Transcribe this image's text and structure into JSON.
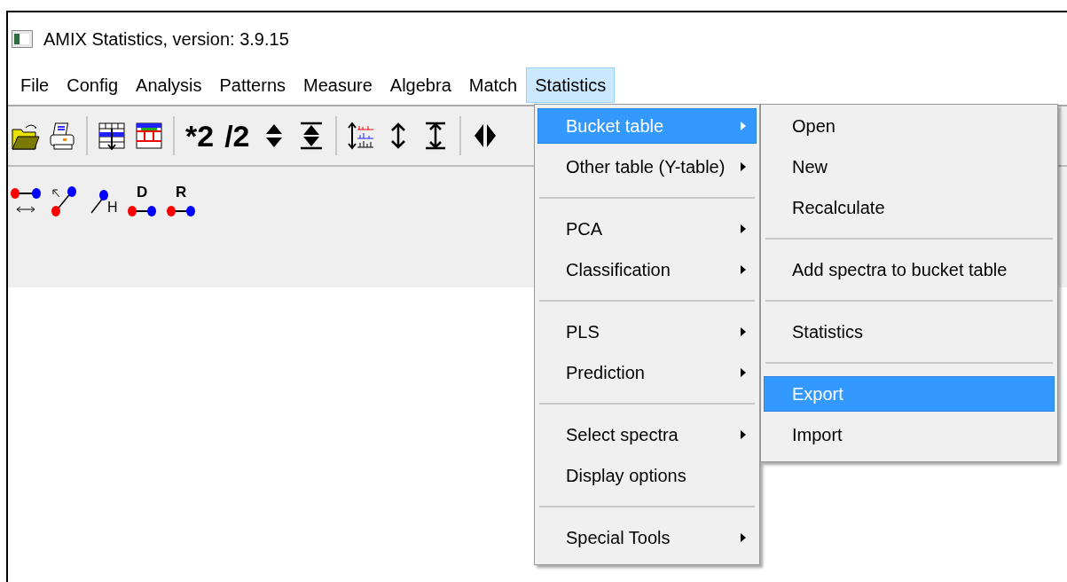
{
  "window": {
    "title": "AMIX Statistics, version: 3.9.15"
  },
  "menubar": [
    {
      "label": "File",
      "selected": false
    },
    {
      "label": "Config",
      "selected": false
    },
    {
      "label": "Analysis",
      "selected": false
    },
    {
      "label": "Patterns",
      "selected": false
    },
    {
      "label": "Measure",
      "selected": false
    },
    {
      "label": "Algebra",
      "selected": false
    },
    {
      "label": "Match",
      "selected": false
    },
    {
      "label": "Statistics",
      "selected": true
    }
  ],
  "toolbar": [
    {
      "kind": "open"
    },
    {
      "kind": "print"
    },
    {
      "kind": "sep"
    },
    {
      "kind": "table-down"
    },
    {
      "kind": "table-color"
    },
    {
      "kind": "sep"
    },
    {
      "kind": "text",
      "label": "*2"
    },
    {
      "kind": "text",
      "label": "/2"
    },
    {
      "kind": "updown"
    },
    {
      "kind": "updown-bars"
    },
    {
      "kind": "sep"
    },
    {
      "kind": "spectra"
    },
    {
      "kind": "vert-arrow"
    },
    {
      "kind": "vert-arrow-bars"
    },
    {
      "kind": "sep"
    },
    {
      "kind": "leftright"
    }
  ],
  "toolbar2": [
    {
      "kind": "bond-h"
    },
    {
      "kind": "bond-diag"
    },
    {
      "kind": "bond-hyd",
      "label": "H"
    },
    {
      "kind": "bond-letter",
      "label": "D"
    },
    {
      "kind": "bond-letter",
      "label": "R"
    }
  ],
  "menu": [
    {
      "kind": "item",
      "label": "Bucket table",
      "submenu": true,
      "selected": true
    },
    {
      "kind": "item",
      "label": "Other table (Y-table)",
      "submenu": true,
      "selected": false
    },
    {
      "kind": "separator"
    },
    {
      "kind": "item",
      "label": "PCA",
      "submenu": true,
      "selected": false
    },
    {
      "kind": "item",
      "label": "Classification",
      "submenu": true,
      "selected": false
    },
    {
      "kind": "separator"
    },
    {
      "kind": "item",
      "label": "PLS",
      "submenu": true,
      "selected": false
    },
    {
      "kind": "item",
      "label": "Prediction",
      "submenu": true,
      "selected": false
    },
    {
      "kind": "separator"
    },
    {
      "kind": "item",
      "label": "Select spectra",
      "submenu": true,
      "selected": false
    },
    {
      "kind": "item",
      "label": "Display options",
      "submenu": false,
      "selected": false
    },
    {
      "kind": "separator"
    },
    {
      "kind": "item",
      "label": "Special Tools",
      "submenu": true,
      "selected": false
    }
  ],
  "submenu": [
    {
      "kind": "item",
      "label": "Open",
      "submenu": false,
      "selected": false
    },
    {
      "kind": "item",
      "label": "New",
      "submenu": false,
      "selected": false
    },
    {
      "kind": "item",
      "label": "Recalculate",
      "submenu": false,
      "selected": false
    },
    {
      "kind": "separator"
    },
    {
      "kind": "item",
      "label": "Add spectra to bucket table",
      "submenu": false,
      "selected": false
    },
    {
      "kind": "separator"
    },
    {
      "kind": "item",
      "label": "Statistics",
      "submenu": false,
      "selected": false
    },
    {
      "kind": "separator"
    },
    {
      "kind": "item",
      "label": "Export",
      "submenu": false,
      "selected": true
    },
    {
      "kind": "item",
      "label": "Import",
      "submenu": false,
      "selected": false
    }
  ]
}
